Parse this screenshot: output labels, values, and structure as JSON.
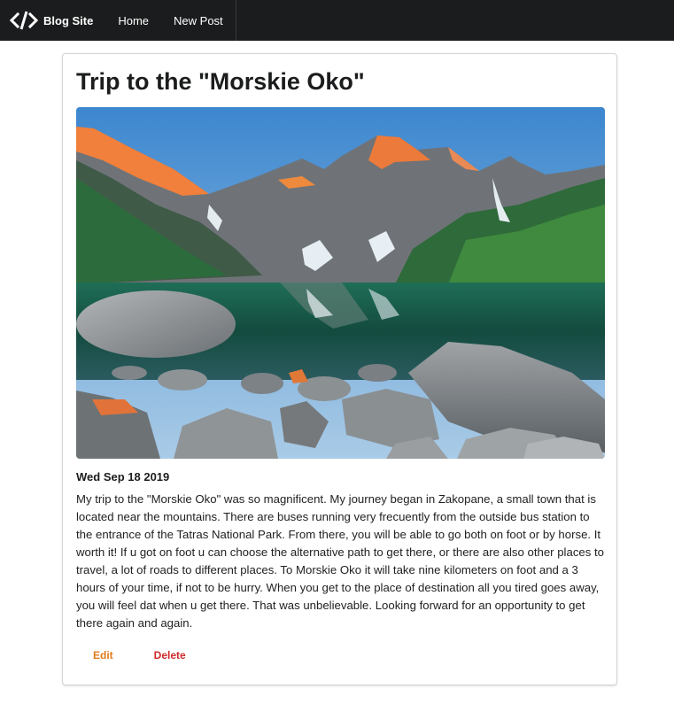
{
  "navbar": {
    "brand_label": "Blog Site",
    "brand_icon": "code-icon",
    "items": [
      {
        "label": "Home"
      },
      {
        "label": "New Post"
      }
    ],
    "background": "#1b1c1d"
  },
  "post": {
    "title": "Trip to the \"Morskie Oko\"",
    "image_alt": "Mountain lake landscape",
    "date": "Wed Sep 18 2019",
    "body": "My trip to the \"Morskie Oko\" was so magnificent. My journey began in Zakopane, a small town that is located near the mountains. There are buses running very frecuently from the outside bus station to the entrance of the Tatras National Park. From there, you will be able to go both on foot or by horse. It worth it! If u got on foot u can choose the alternative path to get there, or there are also other places to travel, a lot of roads to different places. To Morskie Oko it will take nine kilometers on foot and a 3 hours of your time, if not to be hurry. When you get to the place of destination all you tired goes away, you will feel dat when u get there. That was unbelievable. Looking forward for an opportunity to get there again and again.",
    "actions": {
      "edit_label": "Edit",
      "delete_label": "Delete"
    }
  },
  "colors": {
    "edit": "#e07b1a",
    "delete": "#cf2a2a"
  }
}
